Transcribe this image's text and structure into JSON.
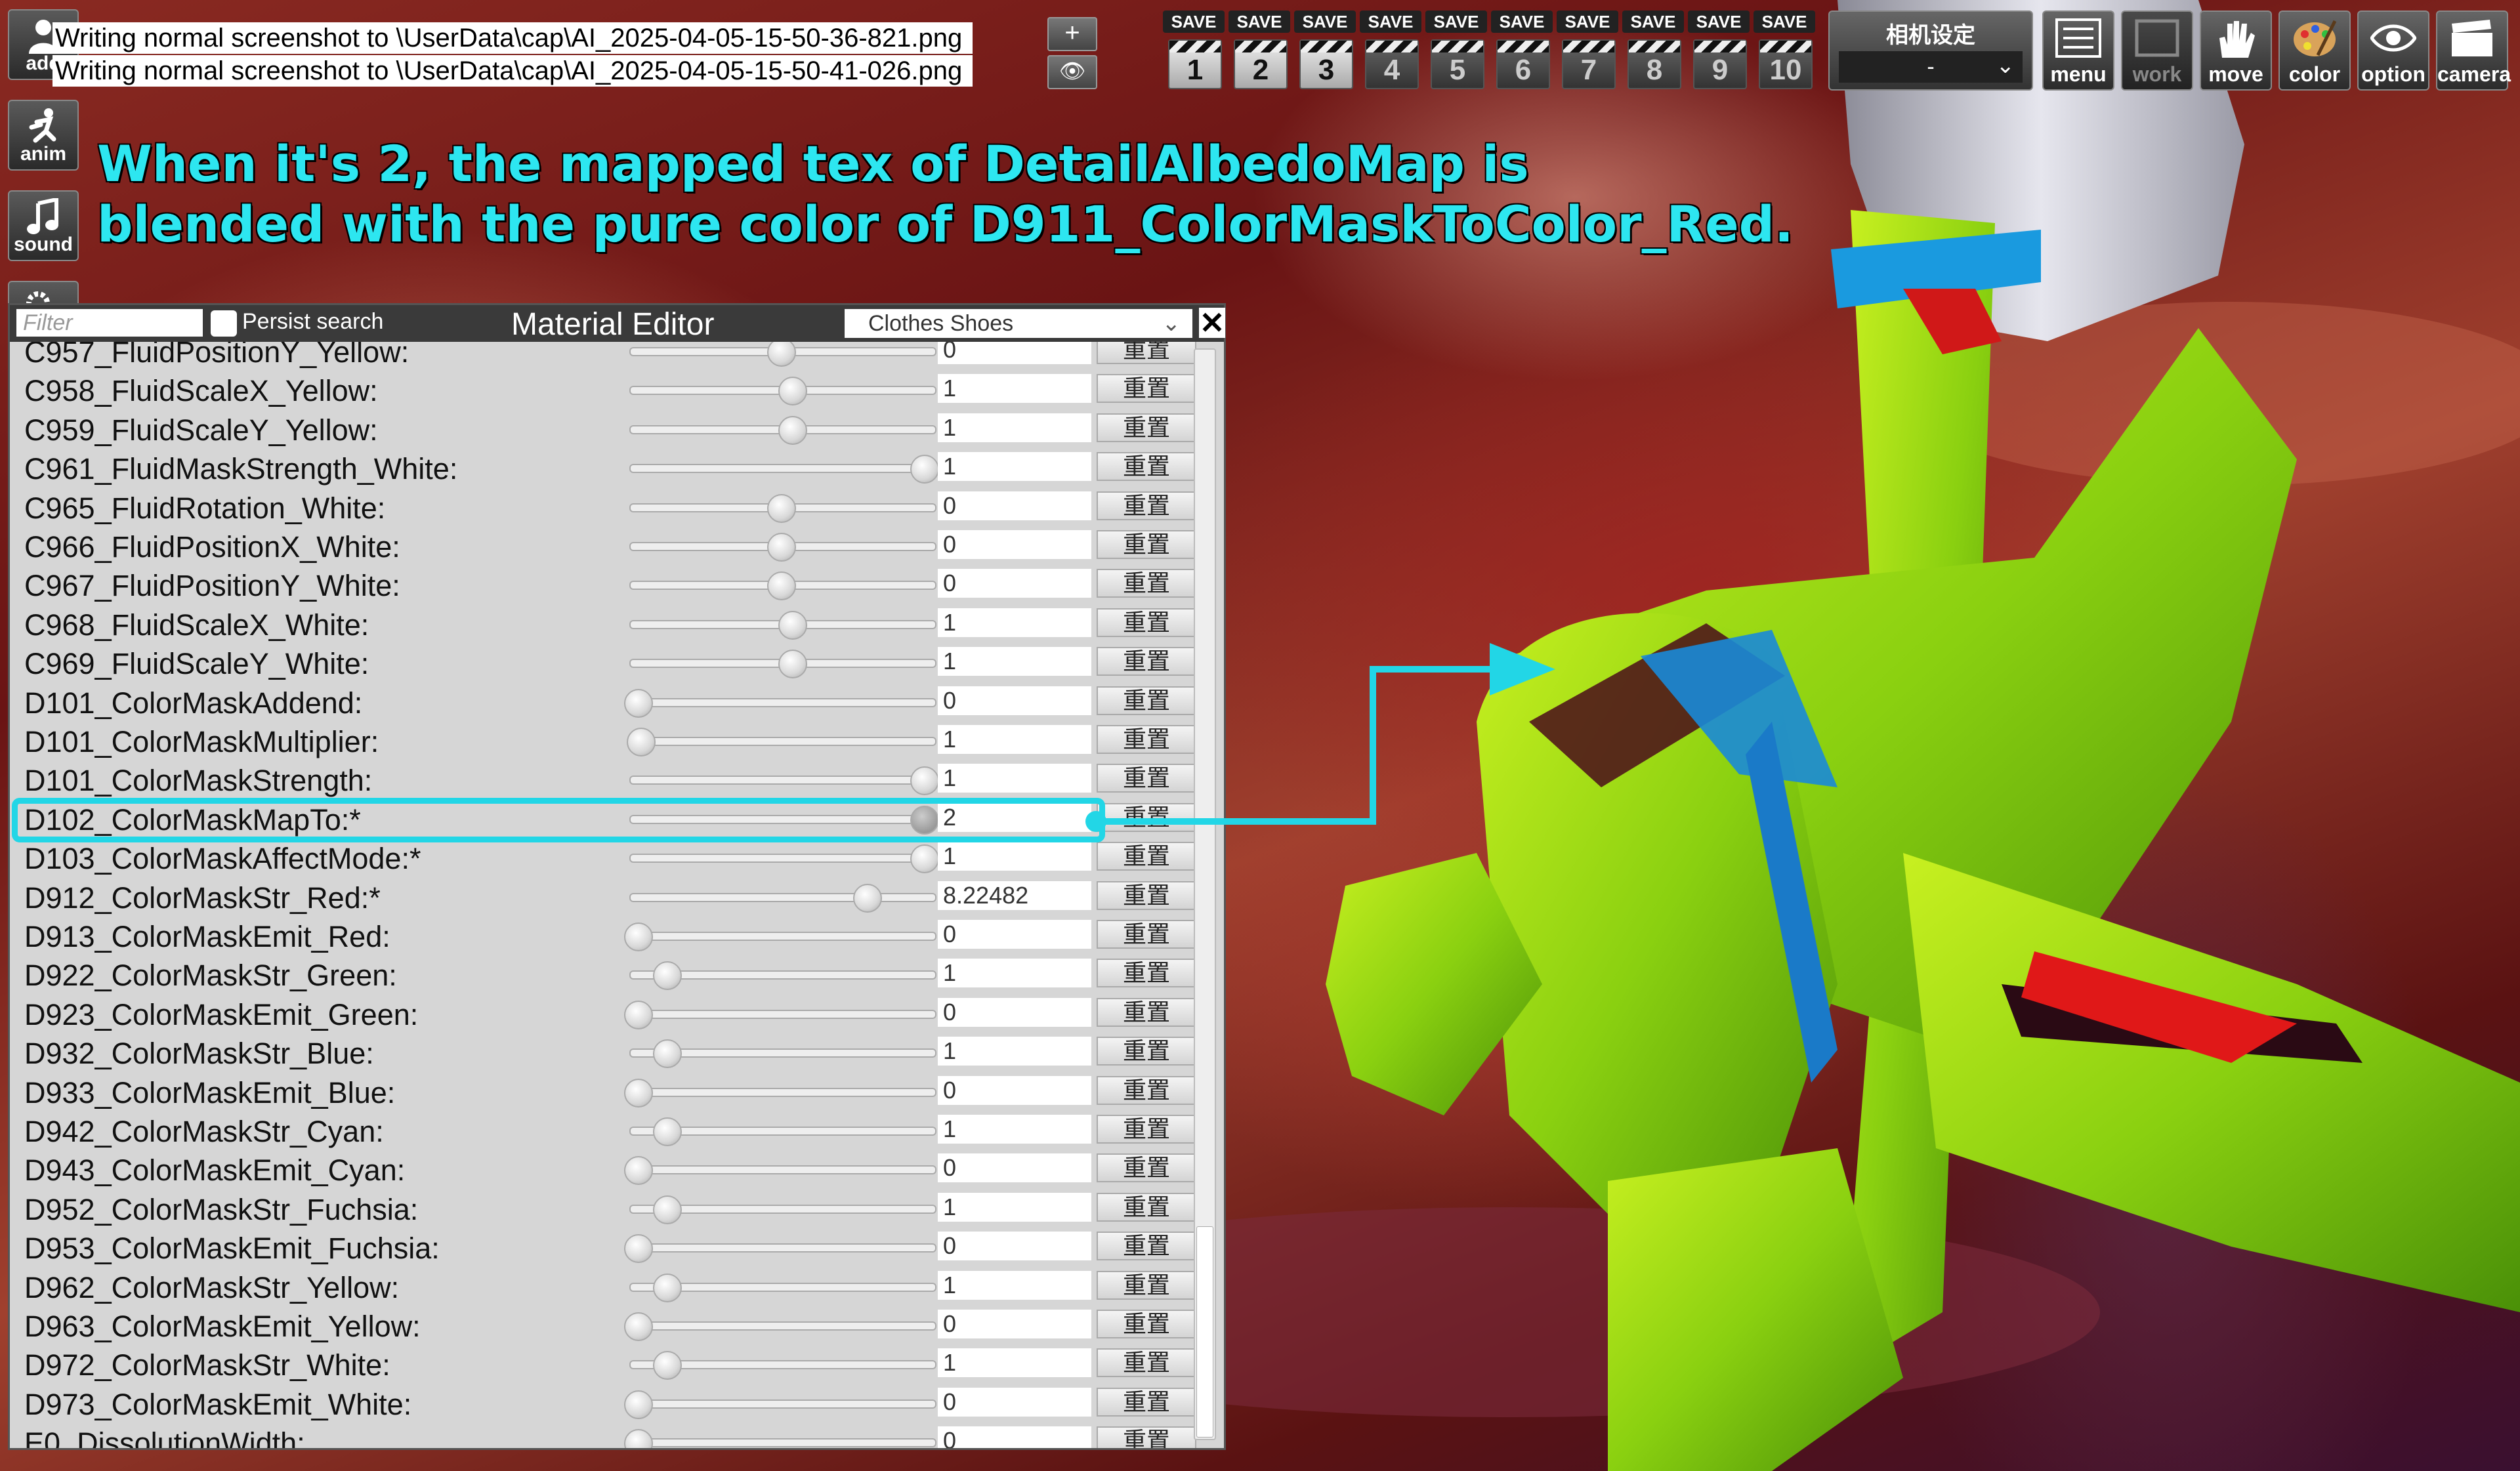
{
  "log": [
    "Writing normal screenshot to \\UserData\\cap\\AI_2025-04-05-15-50-36-821.png",
    "Writing normal screenshot to \\UserData\\cap\\AI_2025-04-05-15-50-41-026.png"
  ],
  "left_icons": [
    {
      "label": "add",
      "icon": "person-add-icon"
    },
    {
      "label": "anim",
      "icon": "running-figure-icon"
    },
    {
      "label": "sound",
      "icon": "music-note-icon"
    },
    {
      "label": "system",
      "icon": "gears-icon"
    }
  ],
  "mini_buttons": {
    "plus": "+",
    "eye": "👁"
  },
  "save_slots": [
    {
      "label": "SAVE",
      "num": "1"
    },
    {
      "label": "SAVE",
      "num": "2"
    },
    {
      "label": "SAVE",
      "num": "3"
    },
    {
      "label": "SAVE",
      "num": "4"
    },
    {
      "label": "SAVE",
      "num": "5"
    },
    {
      "label": "SAVE",
      "num": "6"
    },
    {
      "label": "SAVE",
      "num": "7"
    },
    {
      "label": "SAVE",
      "num": "8"
    },
    {
      "label": "SAVE",
      "num": "9"
    },
    {
      "label": "SAVE",
      "num": "10"
    }
  ],
  "camera_setting": {
    "title": "相机设定",
    "value": "-"
  },
  "toolbar": [
    {
      "label": "menu",
      "icon": "menu-list-icon"
    },
    {
      "label": "work",
      "icon": "work-frame-icon"
    },
    {
      "label": "move",
      "icon": "hand-icon"
    },
    {
      "label": "color",
      "icon": "palette-icon"
    },
    {
      "label": "option",
      "icon": "eye-icon"
    },
    {
      "label": "camera",
      "icon": "camera-clapper-icon"
    }
  ],
  "annotation": {
    "line1": "When it's 2, the mapped tex of DetailAlbedoMap is",
    "line2": "blended with the pure color of D911_ColorMaskToColor_Red."
  },
  "panel": {
    "filter_placeholder": "Filter",
    "persist_label": "Persist search",
    "title": "Material Editor",
    "select_value": "Clothes Shoes",
    "close": "✕",
    "reset_label": "重置",
    "rows": [
      {
        "name": "C957_FluidPositionY_Yellow:",
        "value": "0",
        "level": 0.5
      },
      {
        "name": "C958_FluidScaleX_Yellow:",
        "value": "1",
        "level": 0.54
      },
      {
        "name": "C959_FluidScaleY_Yellow:",
        "value": "1",
        "level": 0.54
      },
      {
        "name": "C961_FluidMaskStrength_White:",
        "value": "1",
        "level": 1.0
      },
      {
        "name": "C965_FluidRotation_White:",
        "value": "0",
        "level": 0.5
      },
      {
        "name": "C966_FluidPositionX_White:",
        "value": "0",
        "level": 0.5
      },
      {
        "name": "C967_FluidPositionY_White:",
        "value": "0",
        "level": 0.5
      },
      {
        "name": "C968_FluidScaleX_White:",
        "value": "1",
        "level": 0.54
      },
      {
        "name": "C969_FluidScaleY_White:",
        "value": "1",
        "level": 0.54
      },
      {
        "name": "D101_ColorMaskAddend:",
        "value": "0",
        "level": 0.0
      },
      {
        "name": "D101_ColorMaskMultiplier:",
        "value": "1",
        "level": 0.01
      },
      {
        "name": "D101_ColorMaskStrength:",
        "value": "1",
        "level": 1.0
      },
      {
        "name": "D102_ColorMaskMapTo:*",
        "value": "2",
        "level": 1.0
      },
      {
        "name": "D103_ColorMaskAffectMode:*",
        "value": "1",
        "level": 1.0
      },
      {
        "name": "D912_ColorMaskStr_Red:*",
        "value": "8.22482",
        "level": 0.8
      },
      {
        "name": "D913_ColorMaskEmit_Red:",
        "value": "0",
        "level": 0.0
      },
      {
        "name": "D922_ColorMaskStr_Green:",
        "value": "1",
        "level": 0.1
      },
      {
        "name": "D923_ColorMaskEmit_Green:",
        "value": "0",
        "level": 0.0
      },
      {
        "name": "D932_ColorMaskStr_Blue:",
        "value": "1",
        "level": 0.1
      },
      {
        "name": "D933_ColorMaskEmit_Blue:",
        "value": "0",
        "level": 0.0
      },
      {
        "name": "D942_ColorMaskStr_Cyan:",
        "value": "1",
        "level": 0.1
      },
      {
        "name": "D943_ColorMaskEmit_Cyan:",
        "value": "0",
        "level": 0.0
      },
      {
        "name": "D952_ColorMaskStr_Fuchsia:",
        "value": "1",
        "level": 0.1
      },
      {
        "name": "D953_ColorMaskEmit_Fuchsia:",
        "value": "0",
        "level": 0.0
      },
      {
        "name": "D962_ColorMaskStr_Yellow:",
        "value": "1",
        "level": 0.1
      },
      {
        "name": "D963_ColorMaskEmit_Yellow:",
        "value": "0",
        "level": 0.0
      },
      {
        "name": "D972_ColorMaskStr_White:",
        "value": "1",
        "level": 0.1
      },
      {
        "name": "D973_ColorMaskEmit_White:",
        "value": "0",
        "level": 0.0
      },
      {
        "name": "E0_DissolutionWidth:",
        "value": "0",
        "level": 0.0
      }
    ]
  },
  "colors": {
    "annotation": "#2de6f0",
    "highlight": "#22d6e6"
  }
}
